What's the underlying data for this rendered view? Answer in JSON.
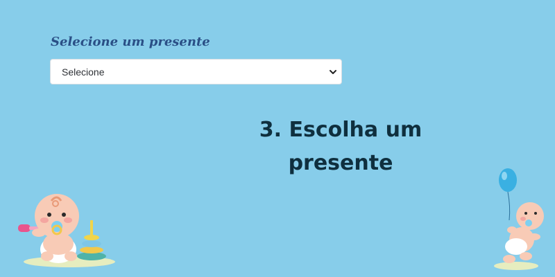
{
  "form": {
    "label": "Selecione um presente",
    "select_value": "Selecione"
  },
  "step": {
    "title": "3. Escolha um presente"
  },
  "icons": {
    "select_chevron": "chevron-down-icon",
    "illustration_left": "baby-with-toy-rings-icon",
    "illustration_right": "baby-with-balloon-icon"
  },
  "colors": {
    "background": "#87cdea",
    "label": "#2a4f86",
    "title": "#0f2f3e"
  }
}
